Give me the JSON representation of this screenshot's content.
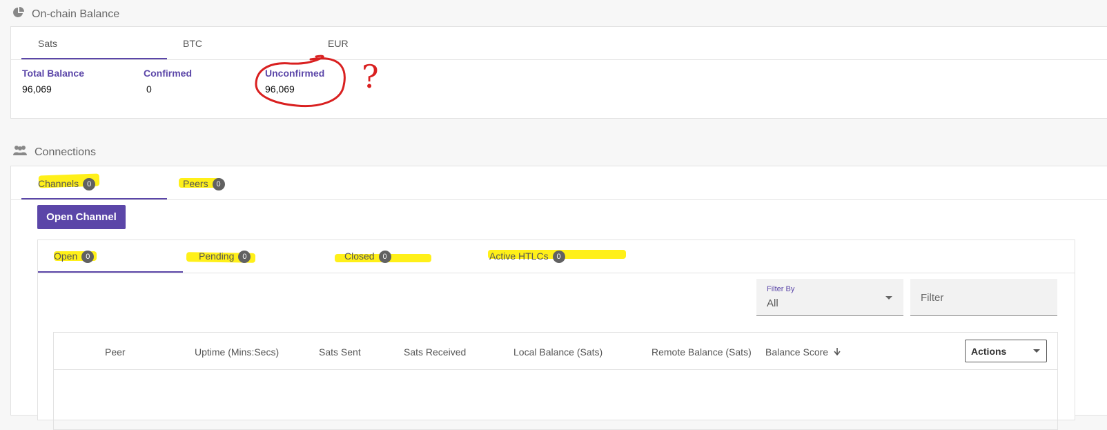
{
  "onchain": {
    "title": "On-chain Balance",
    "tabs": [
      "Sats",
      "BTC",
      "EUR"
    ],
    "total_label": "Total Balance",
    "total_value": "96,069",
    "confirmed_label": "Confirmed",
    "confirmed_value": "0",
    "unconfirmed_label": "Unconfirmed",
    "unconfirmed_value": "96,069",
    "annotation_question": "?"
  },
  "connections": {
    "title": "Connections",
    "tabs": [
      {
        "label": "Channels",
        "count": "0"
      },
      {
        "label": "Peers",
        "count": "0"
      }
    ],
    "open_channel_label": "Open Channel",
    "subtabs": [
      {
        "label": "Open",
        "count": "0"
      },
      {
        "label": "Pending",
        "count": "0"
      },
      {
        "label": "Closed",
        "count": "0"
      },
      {
        "label": "Active HTLCs",
        "count": "0"
      }
    ],
    "filter_by_label": "Filter By",
    "filter_by_value": "All",
    "filter_placeholder": "Filter",
    "columns": [
      "Peer",
      "Uptime (Mins:Secs)",
      "Sats Sent",
      "Sats Received",
      "Local Balance (Sats)",
      "Remote Balance (Sats)",
      "Balance Score"
    ],
    "actions_label": "Actions"
  },
  "colors": {
    "accent": "#5b46a8",
    "highlight": "#ffee00",
    "annotation": "#d92020"
  }
}
